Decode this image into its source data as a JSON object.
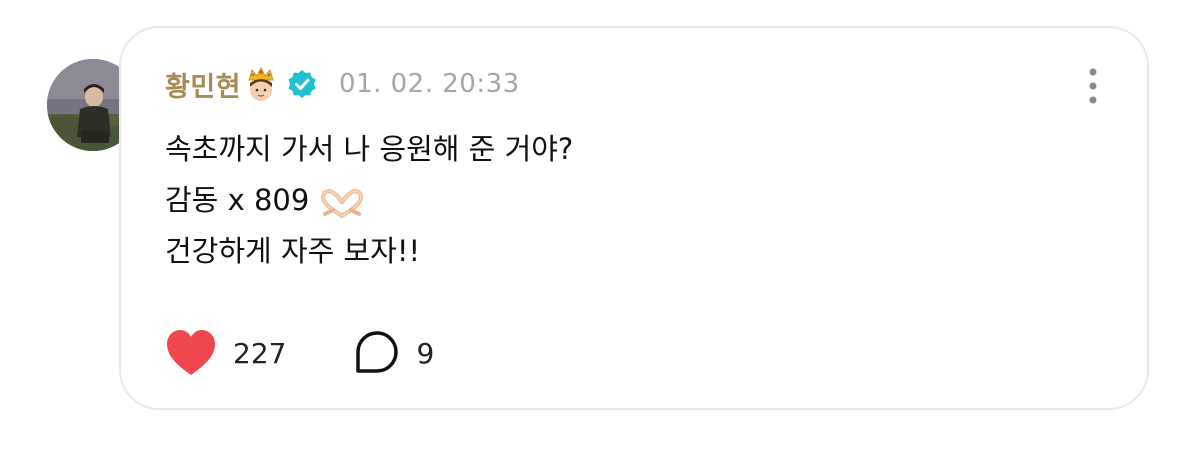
{
  "post": {
    "author": {
      "name": "황민현",
      "badge_emoji": "crowned-face-emoji",
      "verified_icon": "verified-check-icon",
      "avatar": "profile-photo"
    },
    "timestamp": "01. 02. 20:33",
    "body_lines": [
      "속초까지 가서 나 응원해 준 거야?",
      "감동 x 809",
      "건강하게 자주 보자!!"
    ],
    "body_emoji": "heart-hands-emoji",
    "likes": {
      "icon": "heart-icon",
      "count": "227"
    },
    "comments": {
      "icon": "speech-bubble-icon",
      "count": "9"
    },
    "menu_icon": "more-vertical-icon"
  },
  "colors": {
    "author_name": "#a98a55",
    "timestamp": "#a6a6a6",
    "verified": "#22c1cf",
    "heart": "#f0464f",
    "card_border": "#e9e9e9"
  }
}
